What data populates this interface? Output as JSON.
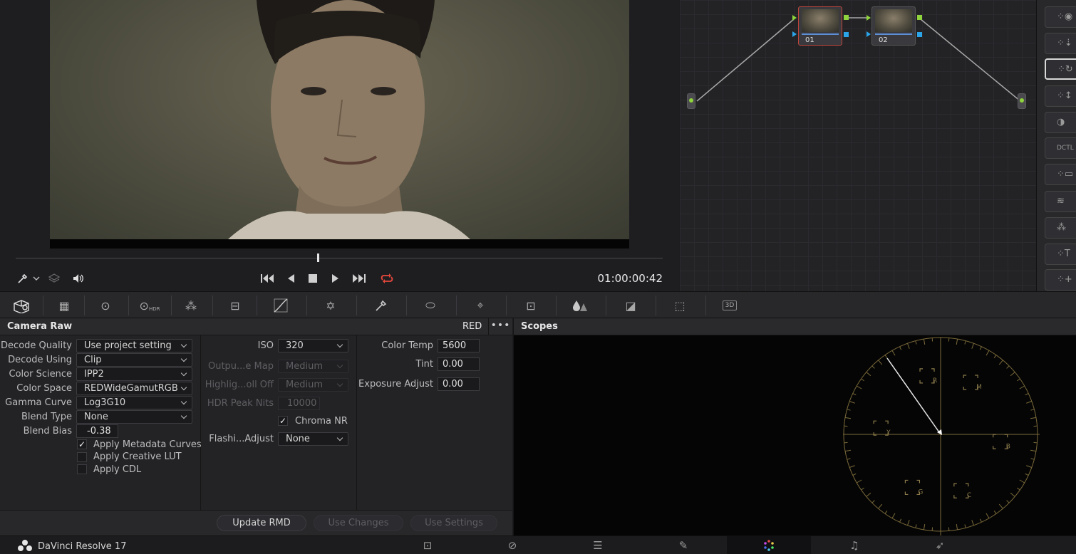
{
  "viewer": {
    "timecode": "01:00:00:42"
  },
  "nodes": [
    {
      "label": "01",
      "selected": true
    },
    {
      "label": "02",
      "selected": false
    }
  ],
  "toolstrip": {
    "tools": [
      "eye-icon",
      "download-node-icon",
      "rotate-node-icon",
      "split-node-icon",
      "contrast-icon",
      "octl-icon",
      "layer-icon",
      "waveform-icon",
      "bulb-icon",
      "node-t-icon",
      "node-plus-icon"
    ],
    "tool_caption": "DCTL"
  },
  "palette": {
    "hdr_label": "HDR",
    "three_d_label": "3D"
  },
  "camera_raw": {
    "title": "Camera Raw",
    "source": "RED",
    "options_label": "•••",
    "col1": {
      "decode_quality_label": "Decode Quality",
      "decode_quality_value": "Use project setting",
      "decode_using_label": "Decode Using",
      "decode_using_value": "Clip",
      "color_science_label": "Color Science",
      "color_science_value": "IPP2",
      "color_space_label": "Color Space",
      "color_space_value": "REDWideGamutRGB",
      "gamma_curve_label": "Gamma Curve",
      "gamma_curve_value": "Log3G10",
      "blend_type_label": "Blend Type",
      "blend_type_value": "None",
      "blend_bias_label": "Blend Bias",
      "blend_bias_value": "-0.38",
      "apply_metadata_curves_label": "Apply Metadata Curves",
      "apply_metadata_curves_checked": true,
      "apply_creative_lut_label": "Apply Creative LUT",
      "apply_creative_lut_checked": false,
      "apply_cdl_label": "Apply CDL",
      "apply_cdl_checked": false
    },
    "col2": {
      "iso_label": "ISO",
      "iso_value": "320",
      "output_map_label": "Outpu...e Map",
      "output_map_value": "Medium",
      "highlight_rolloff_label": "Highlig...oll Off",
      "highlight_rolloff_value": "Medium",
      "hdr_peak_nits_label": "HDR Peak Nits",
      "hdr_peak_nits_value": "10000",
      "chroma_nr_label": "Chroma NR",
      "chroma_nr_checked": true,
      "flashing_adjust_label": "Flashi...Adjust",
      "flashing_adjust_value": "None"
    },
    "col3": {
      "color_temp_label": "Color Temp",
      "color_temp_value": "5600",
      "tint_label": "Tint",
      "tint_value": "0.00",
      "exposure_adjust_label": "Exposure Adjust",
      "exposure_adjust_value": "0.00"
    },
    "footer": {
      "update_rmd_label": "Update RMD",
      "use_changes_label": "Use Changes",
      "use_settings_label": "Use Settings"
    }
  },
  "scopes": {
    "title": "Scopes",
    "targets": [
      "R",
      "M",
      "B",
      "C",
      "G",
      "Y"
    ]
  },
  "status": {
    "app_name": "DaVinci Resolve 17",
    "pages": [
      "media-icon",
      "cut-icon",
      "edit-icon",
      "fusion-icon",
      "color-icon",
      "fairlight-icon",
      "deliver-icon"
    ],
    "active_page": "color-icon"
  }
}
